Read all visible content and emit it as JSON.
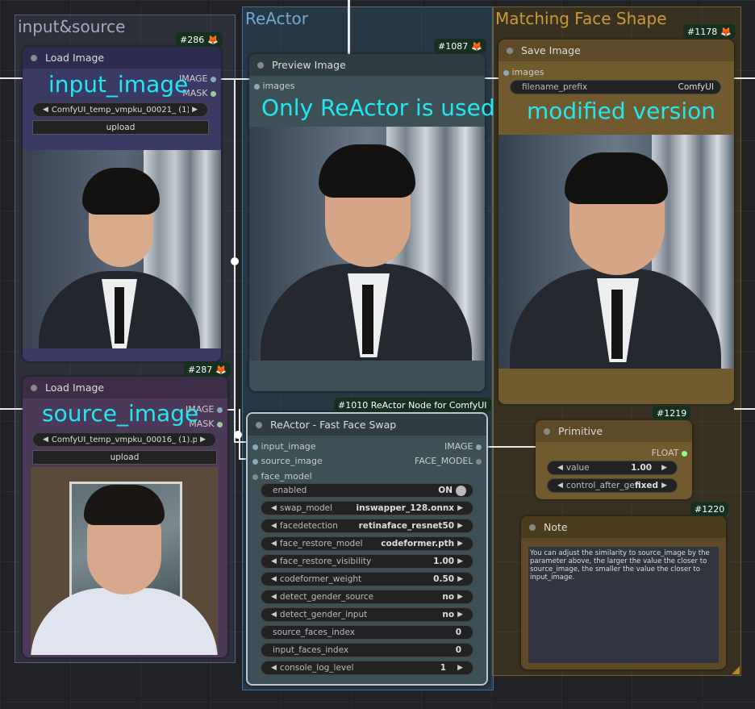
{
  "groups": {
    "input_source": {
      "title": "input&source",
      "color": "#8b8fb0"
    },
    "reactor": {
      "title": "ReActor",
      "color": "#6aa9d6"
    },
    "matching": {
      "title": "Matching Face Shape",
      "color": "#b38a2c"
    }
  },
  "nodes": {
    "load_image_1": {
      "badge": "#286",
      "title": "Load Image",
      "outputs": [
        "IMAGE",
        "MASK"
      ],
      "file": "ComfyUI_temp_vmpku_00021_ (1).png",
      "upload": "upload",
      "overlay": "input_image"
    },
    "load_image_2": {
      "badge": "#287",
      "title": "Load Image",
      "outputs": [
        "IMAGE",
        "MASK"
      ],
      "file": "ComfyUI_temp_vmpku_00016_ (1).png",
      "upload": "upload",
      "overlay": "source_image"
    },
    "preview": {
      "badge": "#1087",
      "title": "Preview Image",
      "input": "images",
      "overlay": "Only ReActor is used"
    },
    "save": {
      "badge": "#1178",
      "title": "Save Image",
      "input": "images",
      "prefix_label": "filename_prefix",
      "prefix_value": "ComfyUI",
      "overlay": "modified version"
    },
    "reactor": {
      "badge": "#1010 ReActor Node for ComfyUI",
      "title": "ReActor - Fast Face Swap",
      "inputs": [
        "input_image",
        "source_image",
        "face_model"
      ],
      "outputs": [
        "IMAGE",
        "FACE_MODEL"
      ],
      "widgets": [
        {
          "label": "enabled",
          "value": "ON"
        },
        {
          "label": "swap_model",
          "value": "inswapper_128.onnx"
        },
        {
          "label": "facedetection",
          "value": "retinaface_resnet50"
        },
        {
          "label": "face_restore_model",
          "value": "codeformer.pth"
        },
        {
          "label": "face_restore_visibility",
          "value": "1.00"
        },
        {
          "label": "codeformer_weight",
          "value": "0.50"
        },
        {
          "label": "detect_gender_source",
          "value": "no"
        },
        {
          "label": "detect_gender_input",
          "value": "no"
        },
        {
          "label": "source_faces_index",
          "value": "0"
        },
        {
          "label": "input_faces_index",
          "value": "0"
        },
        {
          "label": "console_log_level",
          "value": "1"
        }
      ]
    },
    "primitive": {
      "badge": "#1219",
      "title": "Primitive",
      "output": "FLOAT",
      "value_label": "value",
      "value": "1.00",
      "control_label": "control_after_generate",
      "control_value": "fixed"
    },
    "note": {
      "badge": "#1220",
      "title": "Note",
      "text": "You can adjust the similarity to source_image by the parameter above, the larger the value the closer to source_image, the smaller the value the closer to input_image."
    }
  }
}
